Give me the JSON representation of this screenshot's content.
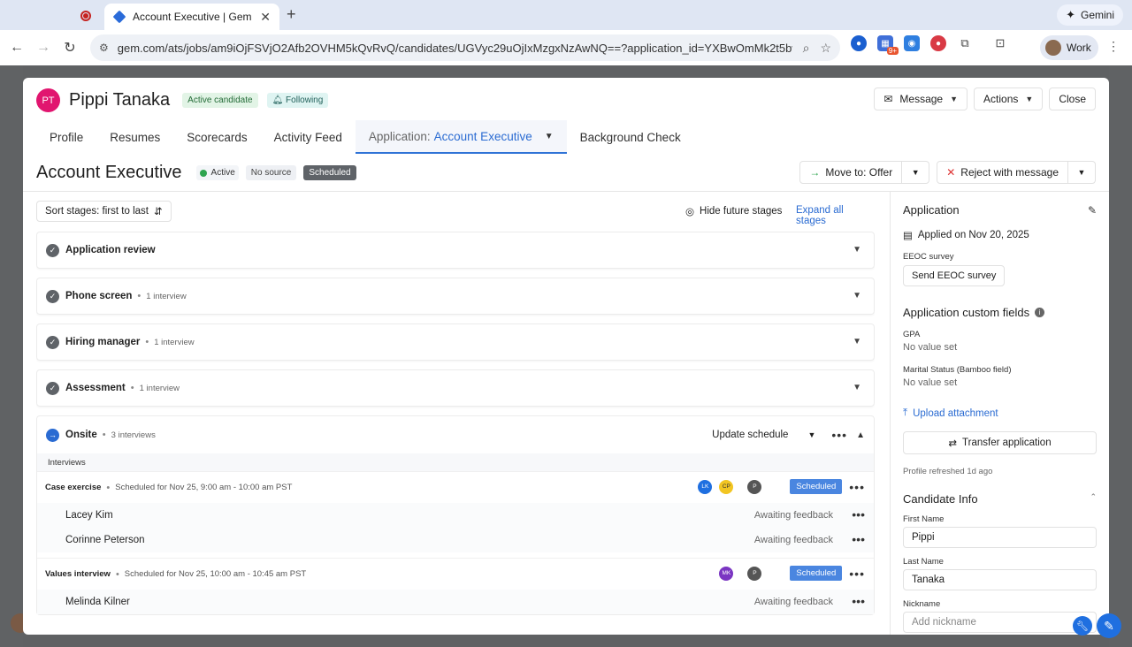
{
  "browser": {
    "tab_title": "Account Executive | Gem",
    "url": "gem.com/ats/jobs/am9iOjFSVjO2Afb2OVHM5kQvRvQ/candidates/UGVyc29uOjIxMzgxNzAwNQ==?application_id=YXBwOmMk2t5bw...",
    "gemini_label": "Gemini",
    "profile_label": "Work",
    "ext_badge": "9+"
  },
  "candidate": {
    "initials": "PT",
    "name": "Pippi Tanaka",
    "status_badge": "Active candidate",
    "following_badge": "Following"
  },
  "header_buttons": {
    "message": "Message",
    "actions": "Actions",
    "close": "Close"
  },
  "tabs": {
    "profile": "Profile",
    "resumes": "Resumes",
    "scorecards": "Scorecards",
    "activity": "Activity Feed",
    "application_prefix": "Application:",
    "application_job": "Account Executive",
    "background": "Background Check"
  },
  "job": {
    "title": "Account Executive",
    "status": "Active",
    "source": "No source",
    "schedule_tag": "Scheduled",
    "move_to": "Move to: Offer",
    "reject": "Reject with message"
  },
  "stages_toolbar": {
    "sort": "Sort stages: first to last",
    "hide_future": "Hide future stages",
    "expand_all": "Expand all stages"
  },
  "stages": [
    {
      "name": "Application review",
      "sub": ""
    },
    {
      "name": "Phone screen",
      "sub": "1 interview"
    },
    {
      "name": "Hiring manager",
      "sub": "1 interview"
    },
    {
      "name": "Assessment",
      "sub": "1 interview"
    }
  ],
  "onsite": {
    "name": "Onsite",
    "sub": "3 interviews",
    "update_schedule": "Update schedule",
    "interviews_header": "Interviews",
    "interviews": [
      {
        "name": "Case exercise",
        "time": "Scheduled for Nov 25, 9:00 am - 10:00 am PST",
        "avatars": [
          "LK",
          "CP",
          "P"
        ],
        "status": "Scheduled",
        "interviewers": [
          {
            "name": "Lacey Kim",
            "status": "Awaiting feedback"
          },
          {
            "name": "Corinne Peterson",
            "status": "Awaiting feedback"
          }
        ]
      },
      {
        "name": "Values interview",
        "time": "Scheduled for Nov 25, 10:00 am - 10:45 am PST",
        "avatars": [
          "MK",
          "P"
        ],
        "status": "Scheduled",
        "interviewers": [
          {
            "name": "Melinda Kilner",
            "status": "Awaiting feedback"
          }
        ]
      }
    ]
  },
  "sidebar": {
    "application_title": "Application",
    "applied_on": "Applied on Nov 20, 2025",
    "eeoc_label": "EEOC survey",
    "eeoc_button": "Send EEOC survey",
    "custom_fields_title": "Application custom fields",
    "gpa_label": "GPA",
    "gpa_value": "No value set",
    "marital_label": "Marital Status (Bamboo field)",
    "marital_value": "No value set",
    "upload": "Upload attachment",
    "transfer": "Transfer application",
    "refreshed": "Profile refreshed 1d ago",
    "candidate_info_title": "Candidate Info",
    "first_name_label": "First Name",
    "first_name": "Pippi",
    "last_name_label": "Last Name",
    "last_name": "Tanaka",
    "nickname_label": "Nickname",
    "nickname_placeholder": "Add nickname"
  },
  "colors": {
    "accent_blue": "#2a6bd2",
    "avatar_pink": "#e1156f",
    "active_green": "#2ea44f",
    "scheduled_blue": "#4a86e0"
  }
}
